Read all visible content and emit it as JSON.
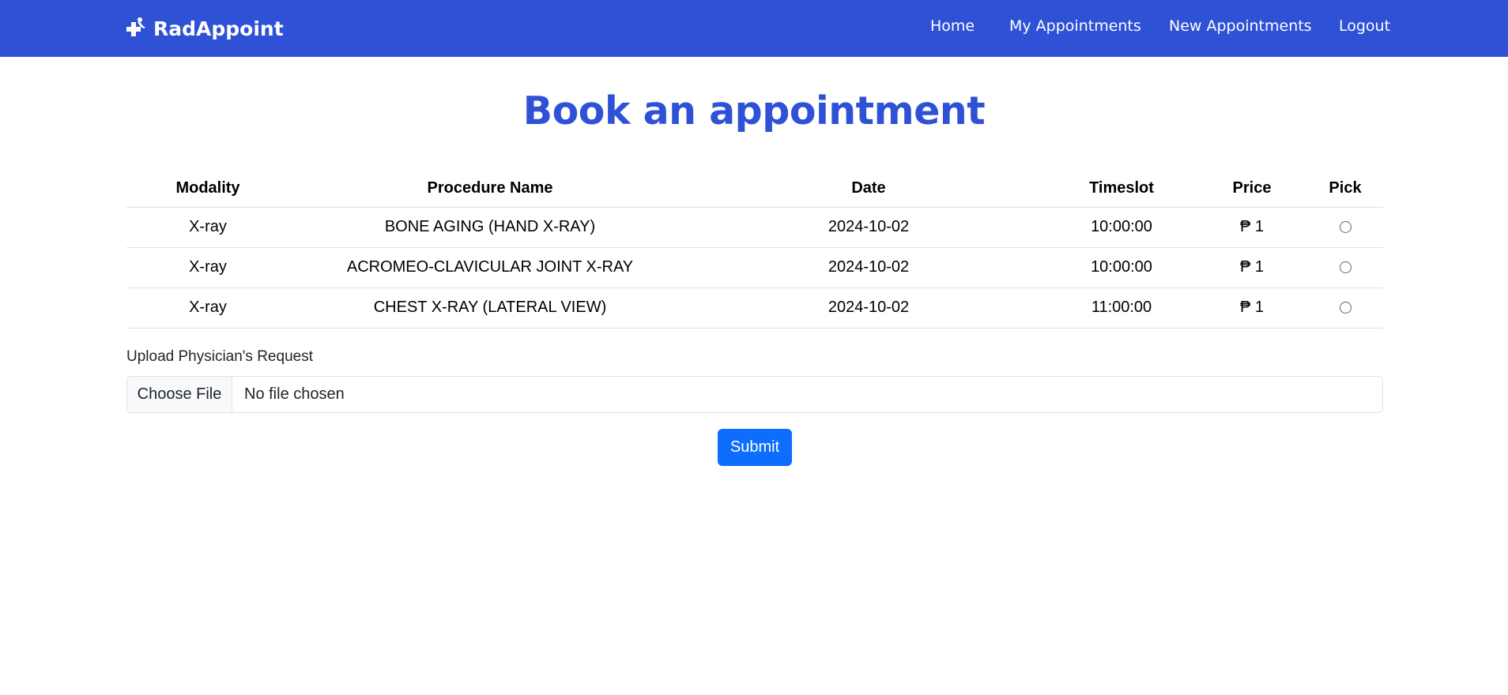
{
  "brand": {
    "name": "RadAppoint",
    "icon": "medical-cross-icon"
  },
  "nav": {
    "home": "Home",
    "my_appointments": "My Appointments",
    "new_appointments": "New Appointments",
    "logout": "Logout"
  },
  "page": {
    "title": "Book an appointment"
  },
  "table": {
    "headers": [
      "Modality",
      "Procedure Name",
      "Date",
      "Timeslot",
      "Price",
      "Pick"
    ],
    "rows": [
      {
        "modality": "X-ray",
        "procedure": "BONE AGING (HAND X-RAY)",
        "date": "2024-10-02",
        "timeslot": "10:00:00",
        "price": "₱ 1"
      },
      {
        "modality": "X-ray",
        "procedure": "ACROMEO-CLAVICULAR JOINT X-RAY",
        "date": "2024-10-02",
        "timeslot": "10:00:00",
        "price": "₱ 1"
      },
      {
        "modality": "X-ray",
        "procedure": "CHEST X-RAY (LATERAL VIEW)",
        "date": "2024-10-02",
        "timeslot": "11:00:00",
        "price": "₱ 1"
      }
    ]
  },
  "upload": {
    "label": "Upload Physician's Request",
    "button": "Choose File",
    "status": "No file chosen"
  },
  "submit": {
    "label": "Submit"
  },
  "colors": {
    "navbar": "#2f51d6",
    "title": "#2f51d6",
    "primary_button": "#0d6efd"
  }
}
